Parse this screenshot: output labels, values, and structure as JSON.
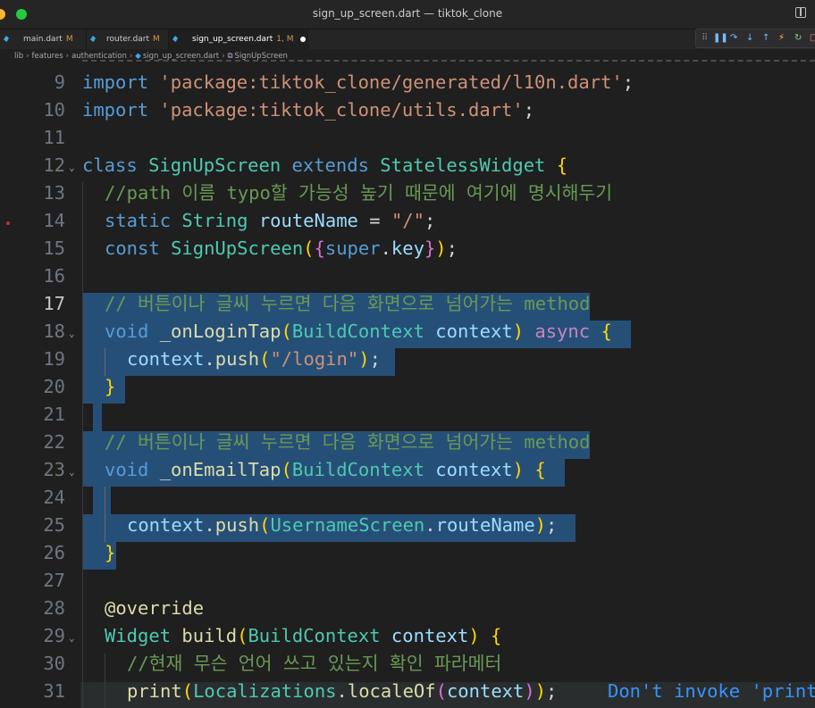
{
  "window": {
    "title": "sign_up_screen.dart — tiktok_clone"
  },
  "tabs": [
    {
      "label": "main.dart",
      "status": "M"
    },
    {
      "label": "router.dart",
      "status": "M"
    },
    {
      "label": "sign_up_screen.dart",
      "status": "1, M"
    }
  ],
  "breadcrumb": [
    "lib",
    "features",
    "authentication",
    "sign_up_screen.dart",
    "SignUpScreen"
  ],
  "colors": {
    "editor_bg": "#1f1f1f",
    "selection": "#264f78",
    "keyword": "#569cd6",
    "type": "#4ec9b0",
    "string": "#ce9178",
    "comment": "#6a9955"
  },
  "lines": [
    {
      "n": "9",
      "text": "import 'package:tiktok_clone/generated/l10n.dart';"
    },
    {
      "n": "10",
      "text": "import 'package:tiktok_clone/utils.dart';"
    },
    {
      "n": "11",
      "text": ""
    },
    {
      "n": "12",
      "text": "class SignUpScreen extends StatelessWidget {"
    },
    {
      "n": "13",
      "text": "//path 이름 typo할 가능성 높기 때문에 여기에 명시해두기"
    },
    {
      "n": "14",
      "text": "static String routeName = \"/\";"
    },
    {
      "n": "15",
      "text": "const SignUpScreen({super.key});"
    },
    {
      "n": "16",
      "text": ""
    },
    {
      "n": "17",
      "text": "// 버튼이나 글씨 누르면 다음 화면으로 넘어가는 method"
    },
    {
      "n": "18",
      "text": "void _onLoginTap(BuildContext context) async {"
    },
    {
      "n": "19",
      "text": "context.push(\"/login\");"
    },
    {
      "n": "20",
      "text": "}"
    },
    {
      "n": "21",
      "text": ""
    },
    {
      "n": "22",
      "text": "// 버튼이나 글씨 누르면 다음 화면으로 넘어가는 method"
    },
    {
      "n": "23",
      "text": "void _onEmailTap(BuildContext context) {"
    },
    {
      "n": "24",
      "text": ""
    },
    {
      "n": "25",
      "text": "context.push(UsernameScreen.routeName);"
    },
    {
      "n": "26",
      "text": "}"
    },
    {
      "n": "27",
      "text": ""
    },
    {
      "n": "28",
      "text": "@override"
    },
    {
      "n": "29",
      "text": "Widget build(BuildContext context) {"
    },
    {
      "n": "30",
      "text": "//현재 무슨 언어 쓰고 있는지 확인 파라메터"
    },
    {
      "n": "31",
      "text": "print(Localizations.localeOf(context));"
    }
  ],
  "inline_hint": "Don't invoke 'print"
}
